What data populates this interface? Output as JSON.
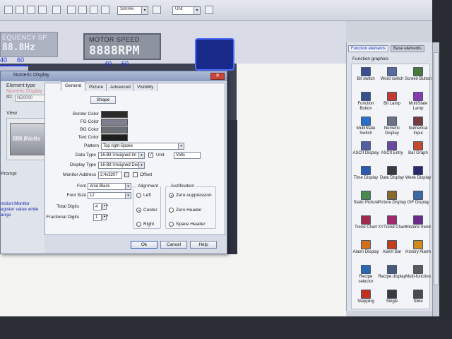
{
  "toolbar": {
    "combo1": "SimHei",
    "combo2": "Unit"
  },
  "canvas": {
    "freq_title": "EQUENCY SP",
    "freq_value": "88.8Hz",
    "motor_title": "MOTOR SPEED",
    "motor_value": "8888RPM",
    "scale_left_a": "40",
    "scale_left_b": "60",
    "scale_mid_a": "40",
    "scale_mid_b": "60"
  },
  "dialog": {
    "title": "Numeric Display",
    "element_type_label": "Element type",
    "element_type_value": "Numeric Display",
    "id_label": "ID:",
    "id_value": "ND0000",
    "view_label": "View",
    "view_value": "888.8Volts",
    "prompt_label": "Prompt",
    "prompt_text_1": "nction:Monitor",
    "prompt_text_2": "egister value while",
    "prompt_text_3": "ange",
    "tabs": [
      "General",
      "Picture",
      "Advanced",
      "Visibility"
    ],
    "shape_button": "Shape",
    "border_color_label": "Border Color",
    "fg_color_label": "FG Color",
    "bg_color_label": "BG Color",
    "text_color_label": "Text Color",
    "pattern_label": "Pattern",
    "pattern_value": "Top right-Spoke",
    "data_type_label": "Data Type",
    "data_type_value": "16-Bit Unsigned Int",
    "unit_label": "Unit",
    "unit_value": "Volts",
    "display_type_label": "Display Type",
    "display_type_value": "16-Bit Unsigned Deci",
    "monitor_address_label": "Monitor Address",
    "monitor_address_value": "2:4x3207",
    "offset_label": "Offset",
    "font_label": "Font",
    "font_value": "Arial Black",
    "font_size_label": "Font Size",
    "font_size_value": "12",
    "total_digits_label": "Total Digits",
    "total_digits_value": "4",
    "fractional_digits_label": "Fractional Digits",
    "fractional_digits_value": "1",
    "alignment_title": "Alignment",
    "align_left": "Left",
    "align_center": "Center",
    "align_right": "Right",
    "justification_title": "Justification",
    "just_zero_suppression": "Zero-suppression",
    "just_zero_header": "Zero Header",
    "just_space_header": "Space Header",
    "ok_button": "Ok",
    "cancel_button": "Cancel",
    "help_button": "Help"
  },
  "right_panel": {
    "tab_function": "Function elements",
    "tab_base": "Base elements",
    "section_title": "Function graphics",
    "items": [
      {
        "label": "Bit switch",
        "icon": "bit-switch-icon",
        "color": "#3a4d8f"
      },
      {
        "label": "Word switch",
        "icon": "word-switch-icon",
        "color": "#5a6aa0"
      },
      {
        "label": "Screen Button",
        "icon": "screen-button-icon",
        "color": "#4a7a3a"
      },
      {
        "label": "Function Button",
        "icon": "function-button-icon",
        "color": "#35508a"
      },
      {
        "label": "Bit Lamp",
        "icon": "bit-lamp-icon",
        "color": "#c23b2e"
      },
      {
        "label": "MultiState Lamp",
        "icon": "multistate-lamp-icon",
        "color": "#8a3ab0"
      },
      {
        "label": "MultiState Switch",
        "icon": "multistate-switch-icon",
        "color": "#2b6ec9"
      },
      {
        "label": "Numeric Display",
        "icon": "numeric-display-icon",
        "color": "#6d7280"
      },
      {
        "label": "Numerical Input",
        "icon": "numerical-input-icon",
        "color": "#7b3a3a"
      },
      {
        "label": "ASCII Display",
        "icon": "ascii-display-icon",
        "color": "#5060a0"
      },
      {
        "label": "ASCII Entry",
        "icon": "ascii-entry-icon",
        "color": "#6a4aa0"
      },
      {
        "label": "Bar Graph",
        "icon": "bar-graph-icon",
        "color": "#c44a2a"
      },
      {
        "label": "Time Display",
        "icon": "time-display-icon",
        "color": "#2a5ab0"
      },
      {
        "label": "Date Display",
        "icon": "date-display-icon",
        "color": "#3a3a3a"
      },
      {
        "label": "Week Display",
        "icon": "week-display-icon",
        "color": "#2a2a6a"
      },
      {
        "label": "Static Picture",
        "icon": "static-picture-icon",
        "color": "#4a8a4a"
      },
      {
        "label": "Picture Display",
        "icon": "picture-display-icon",
        "color": "#8a6a2a"
      },
      {
        "label": "GIF Display",
        "icon": "gif-display-icon",
        "color": "#3a6aa0"
      },
      {
        "label": "Trend Chart",
        "icon": "trend-chart-icon",
        "color": "#a02a4a"
      },
      {
        "label": "XYTrend Chart",
        "icon": "xytrend-chart-icon",
        "color": "#a02a6a"
      },
      {
        "label": "Historic trend",
        "icon": "historic-trend-icon",
        "color": "#6a2a8a"
      },
      {
        "label": "Alarm Display",
        "icon": "alarm-display-icon",
        "color": "#d0701a"
      },
      {
        "label": "Alarm Bar",
        "icon": "alarm-bar-icon",
        "color": "#c0401a"
      },
      {
        "label": "History Alarm",
        "icon": "history-alarm-icon",
        "color": "#d08a1a"
      },
      {
        "label": "Recipe selector",
        "icon": "recipe-selector-icon",
        "color": "#2a6ab0"
      },
      {
        "label": "Recipe display",
        "icon": "recipe-display-icon",
        "color": "#4a5a7a"
      },
      {
        "label": "Multi-function",
        "icon": "multi-function-icon",
        "color": "#5a5a5a"
      },
      {
        "label": "Stepping",
        "icon": "stepping-icon",
        "color": "#c0301a"
      },
      {
        "label": "Single",
        "icon": "single-icon",
        "color": "#3a3a3a"
      },
      {
        "label": "Slide",
        "icon": "slide-icon",
        "color": "#4a4a4a"
      }
    ]
  },
  "colors": {
    "border_color": "#2b2b2b",
    "fg_color": "#7f7f8f",
    "bg_color": "#6b6d74",
    "text_color": "#1e1e1e",
    "accent": "#1a4fbf"
  }
}
